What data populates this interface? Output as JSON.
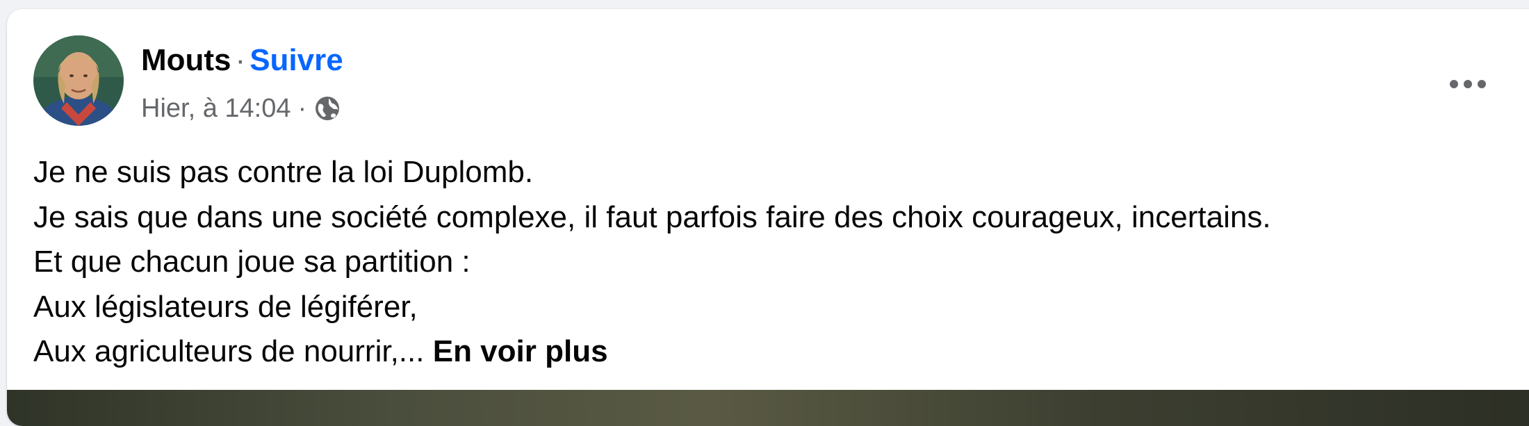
{
  "post": {
    "author": "Mouts",
    "separator": "·",
    "follow_label": "Suivre",
    "timestamp": "Hier, à 14:04",
    "meta_separator": "·",
    "audience_icon": "globe-icon",
    "menu_icon": "more-horizontal-icon",
    "body_lines": [
      "Je ne suis pas contre la loi Duplomb.",
      "Je sais que dans une société complexe, il faut parfois faire des choix courageux, incertains.",
      "Et que chacun joue sa partition :",
      "Aux législateurs de légiférer,",
      "Aux agriculteurs de nourrir,..."
    ],
    "see_more_label": "En voir plus"
  },
  "colors": {
    "link_blue": "#0866ff",
    "secondary_text": "#65676b",
    "primary_text": "#050505",
    "page_background": "#f0f2f5"
  }
}
